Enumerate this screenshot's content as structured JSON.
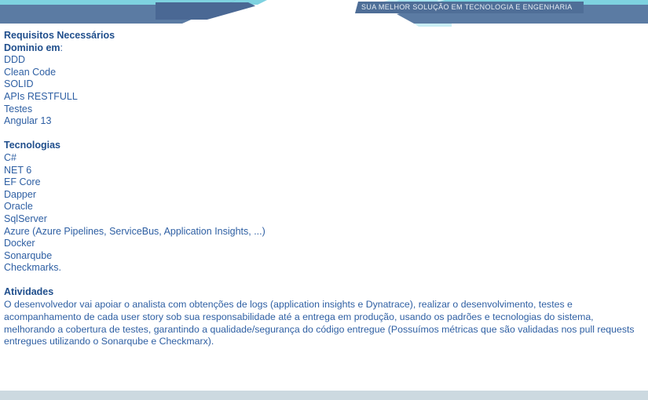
{
  "header": {
    "tagline": "SUA MELHOR SOLUÇÃO EM TECNOLOGIA E ENGENHARIA",
    "colors": {
      "cyan_strip": "#7ed2e0",
      "steel_band": "#5b7ba3",
      "dark_chevron": "#4a6894",
      "ribbon": "#4f6e97",
      "splash": "#c9eef5"
    }
  },
  "sections": {
    "requirements": {
      "title": "Requisitos Necessários",
      "subtitle": "Dominio em",
      "subtitle_punct": ":",
      "items": [
        "DDD",
        "Clean Code",
        "SOLID",
        "APIs RESTFULL",
        "Testes",
        "Angular 13"
      ]
    },
    "technologies": {
      "title": "Tecnologias",
      "items": [
        "C#",
        "NET 6",
        "EF Core",
        "Dapper",
        "Oracle",
        "SqlServer",
        "Azure (Azure Pipelines, ServiceBus, Application Insights, ...)",
        "Docker",
        "Sonarqube",
        "Checkmarks."
      ]
    },
    "activities": {
      "title": "Atividades",
      "body": "O desenvolvedor vai apoiar o analista com obtenções de logs (application insights e Dynatrace), realizar o desenvolvimento, testes e acompanhamento de cada user story sob sua responsabilidade até a entrega em produção, usando os padrões e tecnologias do sistema, melhorando a cobertura de testes, garantindo a qualidade/segurança do código entregue (Possuímos métricas que são validadas nos pull requests entregues utilizando o Sonarqube e Checkmarx)."
    }
  },
  "colors": {
    "heading_text": "#1f4e8c",
    "body_text": "#2e5fa3",
    "footer_bar": "#ccd9e0"
  }
}
